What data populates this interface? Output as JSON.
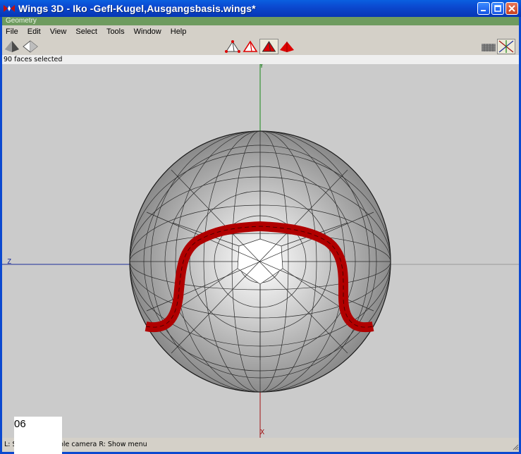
{
  "window": {
    "title": "Wings 3D - Iko -Gefl-Kugel,Ausgangsbasis.wings*",
    "buttons": [
      "minimize",
      "maximize",
      "close"
    ]
  },
  "geometry_strip": {
    "label": "Geometry"
  },
  "menu": {
    "items": [
      "File",
      "Edit",
      "View",
      "Select",
      "Tools",
      "Window",
      "Help"
    ]
  },
  "toolbar": {
    "left_icons": [
      "smooth-shaded-icon",
      "wireframe-icon"
    ],
    "mode_icons": [
      "vertex-mode-icon",
      "edge-mode-icon",
      "face-mode-icon",
      "body-mode-icon"
    ],
    "active_mode": "face",
    "right_icons": [
      "ground-plane-icon",
      "axes-icon"
    ]
  },
  "info": {
    "text": "90 faces selected"
  },
  "viewport": {
    "axis_labels": {
      "y": "Y",
      "z": "Z",
      "x": "X"
    },
    "colors": {
      "background": "#cbcbcb",
      "selection": "#b00000",
      "y_axis": "#1a8a1a",
      "z_axis": "#1e2e9a",
      "x_axis": "#a01010"
    }
  },
  "status": {
    "text": "L: Select   M: Tumble camera   R: Show menu"
  },
  "overlay": {
    "label": "06"
  }
}
